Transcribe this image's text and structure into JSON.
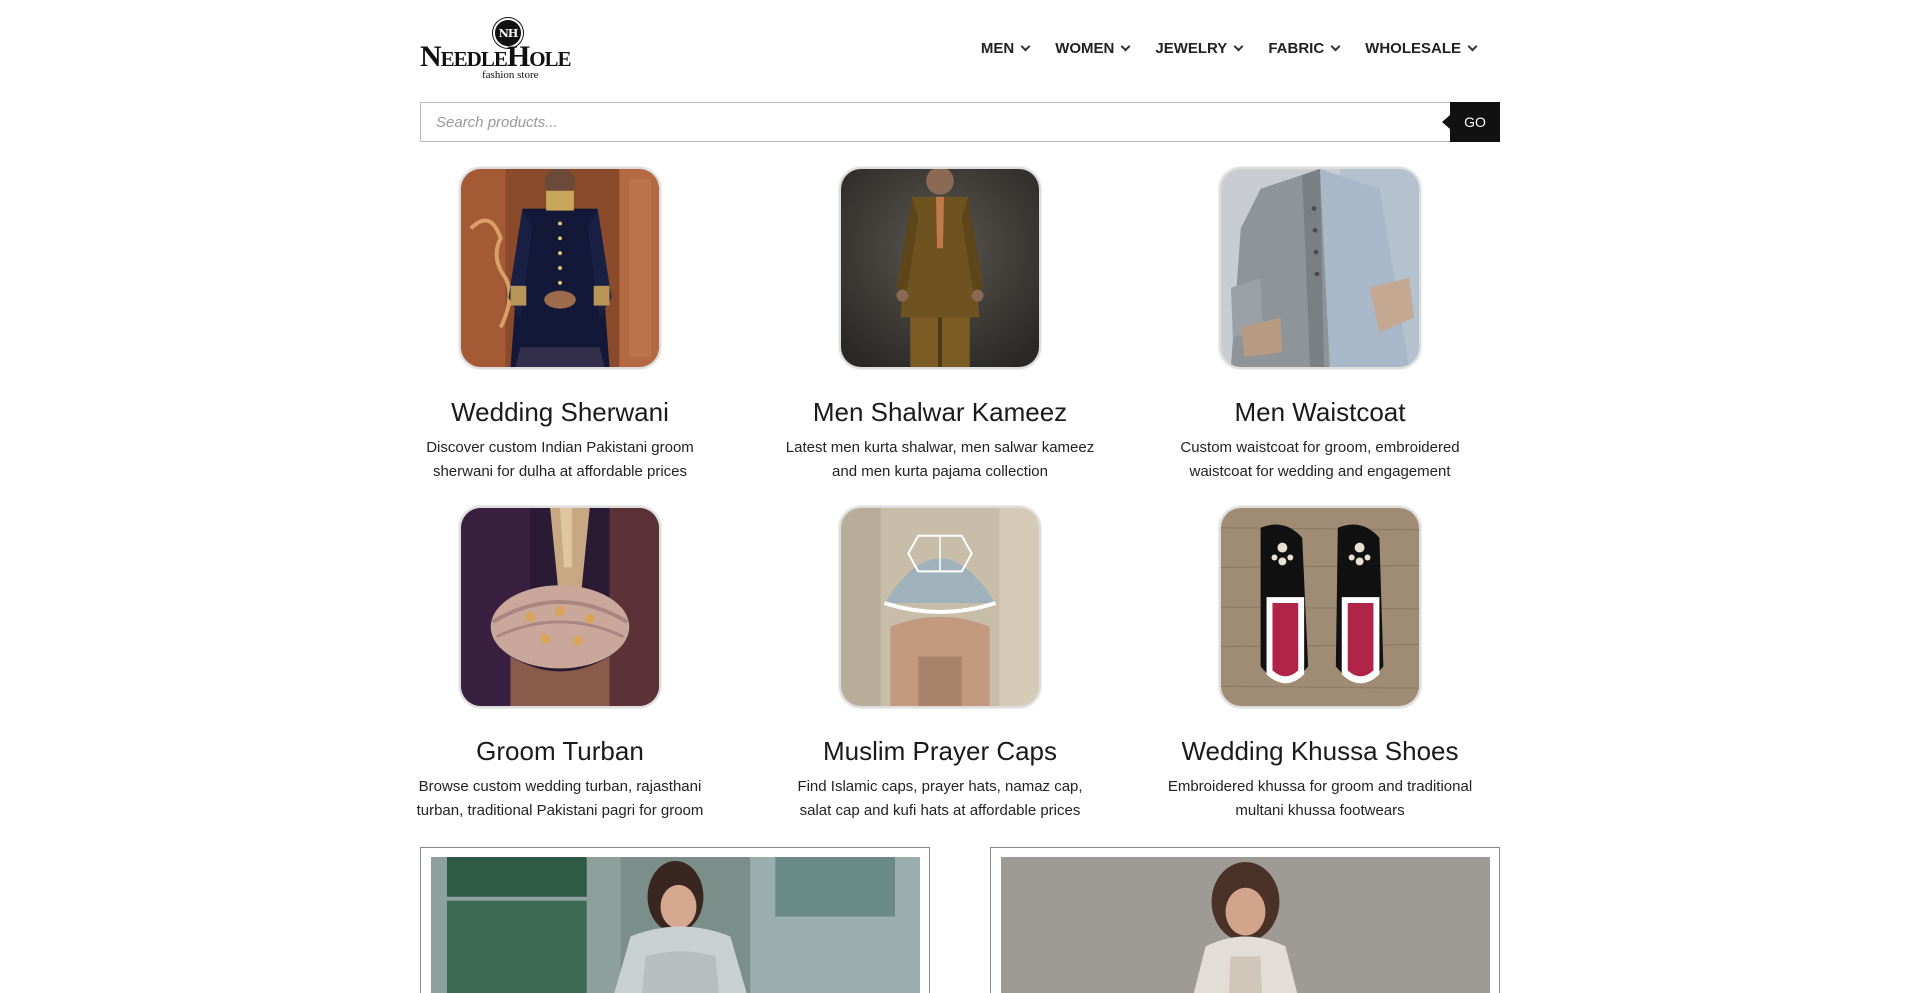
{
  "brand": {
    "logo_badge": "NH",
    "logo_name": "NeedleHole",
    "logo_tagline": "fashion store"
  },
  "nav": [
    {
      "label": "MEN"
    },
    {
      "label": "WOMEN"
    },
    {
      "label": "JEWELRY"
    },
    {
      "label": "FABRIC"
    },
    {
      "label": "WHOLESALE"
    }
  ],
  "search": {
    "placeholder": "Search products...",
    "button_label": "GO"
  },
  "categories": [
    {
      "title": "Wedding Sherwani",
      "description": "Discover custom Indian Pakistani groom sherwani for dulha at affordable prices"
    },
    {
      "title": "Men Shalwar Kameez",
      "description": "Latest men kurta shalwar, men salwar kameez and men kurta pajama collection"
    },
    {
      "title": "Men Waistcoat",
      "description": "Custom waistcoat for groom, embroidered waistcoat for wedding and engagement"
    },
    {
      "title": "Groom Turban",
      "description": "Browse custom wedding turban, rajasthani turban, traditional Pakistani pagri for groom"
    },
    {
      "title": "Muslim Prayer Caps",
      "description": "Find Islamic caps, prayer hats, namaz cap, salat cap and kufi hats at affordable prices"
    },
    {
      "title": "Wedding Khussa Shoes",
      "description": "Embroidered khussa for groom and traditional multani khussa footwears"
    }
  ]
}
